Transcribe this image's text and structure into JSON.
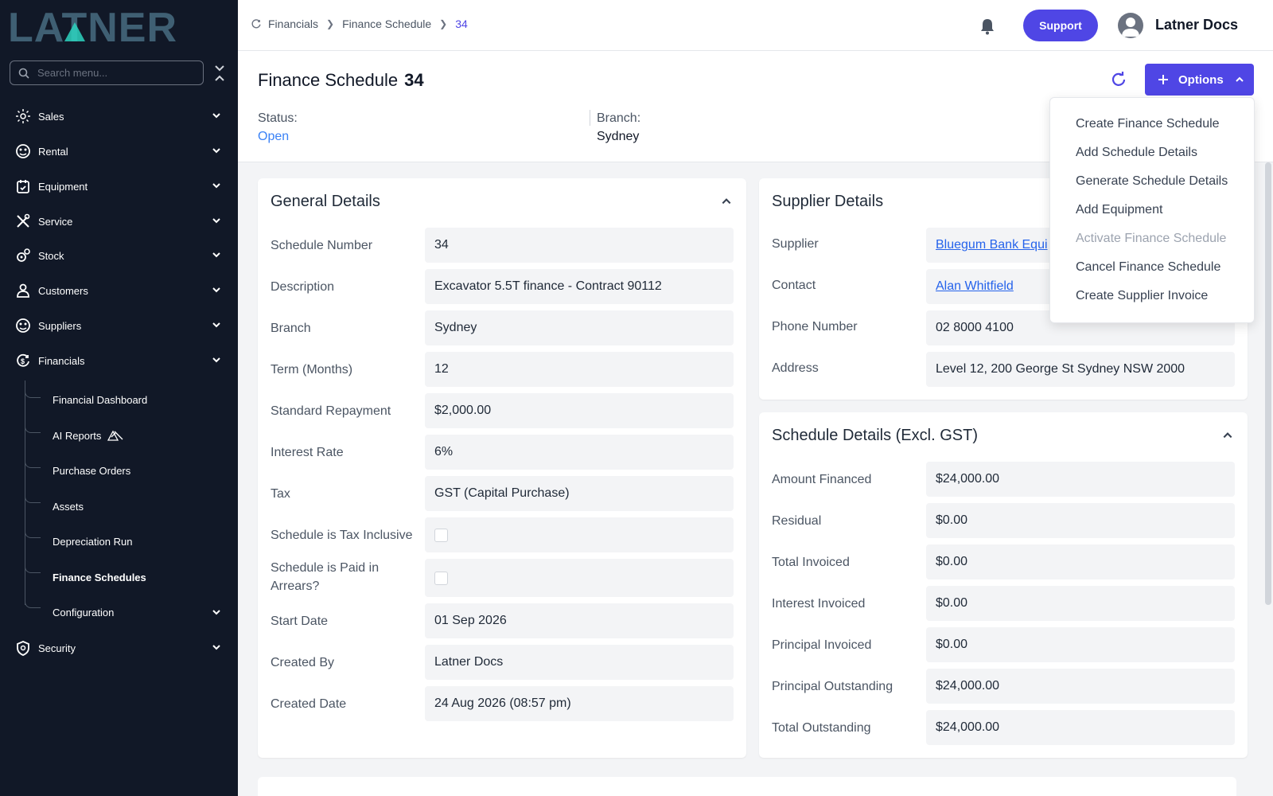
{
  "app": {
    "logo_text": "LATNER"
  },
  "search": {
    "placeholder": "Search menu..."
  },
  "nav": {
    "items": [
      {
        "label": "Sales",
        "icon": "sales-icon"
      },
      {
        "label": "Rental",
        "icon": "rental-icon"
      },
      {
        "label": "Equipment",
        "icon": "equipment-icon"
      },
      {
        "label": "Service",
        "icon": "service-icon"
      },
      {
        "label": "Stock",
        "icon": "stock-icon"
      },
      {
        "label": "Customers",
        "icon": "customers-icon"
      },
      {
        "label": "Suppliers",
        "icon": "suppliers-icon"
      },
      {
        "label": "Financials",
        "icon": "financials-icon"
      },
      {
        "label": "Security",
        "icon": "security-icon"
      }
    ],
    "financials_sub": [
      {
        "label": "Financial Dashboard"
      },
      {
        "label": "AI Reports"
      },
      {
        "label": "Purchase Orders"
      },
      {
        "label": "Assets"
      },
      {
        "label": "Depreciation Run"
      },
      {
        "label": "Finance Schedules"
      },
      {
        "label": "Configuration"
      }
    ]
  },
  "breadcrumb": {
    "root": "Financials",
    "parent": "Finance Schedule",
    "current": "34"
  },
  "topbar": {
    "support_label": "Support",
    "username": "Latner Docs"
  },
  "header": {
    "title": "Finance Schedule",
    "number": "34",
    "status_label": "Status:",
    "status_value": "Open",
    "branch_label": "Branch:",
    "branch_value": "Sydney",
    "options_label": "Options"
  },
  "options_menu": {
    "items": [
      {
        "label": "Create Finance Schedule",
        "enabled": true
      },
      {
        "label": "Add Schedule Details",
        "enabled": true
      },
      {
        "label": "Generate Schedule Details",
        "enabled": true
      },
      {
        "label": "Add Equipment",
        "enabled": true
      },
      {
        "label": "Activate Finance Schedule",
        "enabled": false
      },
      {
        "label": "Cancel Finance Schedule",
        "enabled": true
      },
      {
        "label": "Create Supplier Invoice",
        "enabled": true
      }
    ]
  },
  "general": {
    "title": "General Details",
    "rows": [
      {
        "label": "Schedule Number",
        "value": "34"
      },
      {
        "label": "Description",
        "value": "Excavator 5.5T finance - Contract 90112"
      },
      {
        "label": "Branch",
        "value": "Sydney"
      },
      {
        "label": "Term (Months)",
        "value": "12"
      },
      {
        "label": "Standard Repayment",
        "value": "$2,000.00"
      },
      {
        "label": "Interest Rate",
        "value": "6%"
      },
      {
        "label": "Tax",
        "value": "GST (Capital Purchase)"
      },
      {
        "label": "Schedule is Tax Inclusive",
        "checked": false
      },
      {
        "label": "Schedule is Paid in Arrears?",
        "checked": false
      },
      {
        "label": "Start Date",
        "value": "01 Sep 2026"
      },
      {
        "label": "Created By",
        "value": "Latner Docs"
      },
      {
        "label": "Created Date",
        "value": "24 Aug 2026 (08:57 pm)"
      }
    ]
  },
  "supplier": {
    "title": "Supplier Details",
    "rows": [
      {
        "label": "Supplier",
        "value": "Bluegum Bank Equi"
      },
      {
        "label": "Contact",
        "value": "Alan Whitfield"
      },
      {
        "label": "Phone Number",
        "value": "02 8000 4100"
      },
      {
        "label": "Address",
        "value": "Level 12, 200 George St Sydney NSW 2000"
      }
    ]
  },
  "schedule": {
    "title": "Schedule Details (Excl. GST)",
    "rows": [
      {
        "label": "Amount Financed",
        "value": "$24,000.00"
      },
      {
        "label": "Residual",
        "value": "$0.00"
      },
      {
        "label": "Total Invoiced",
        "value": "$0.00"
      },
      {
        "label": "Interest Invoiced",
        "value": "$0.00"
      },
      {
        "label": "Principal Invoiced",
        "value": "$0.00"
      },
      {
        "label": "Principal Outstanding",
        "value": "$24,000.00"
      },
      {
        "label": "Total Outstanding",
        "value": "$24,000.00"
      }
    ]
  },
  "colors": {
    "accent": "#4f46e5",
    "sidebar": "#111827",
    "status_open": "#3b82f6",
    "link": "#2563eb"
  }
}
